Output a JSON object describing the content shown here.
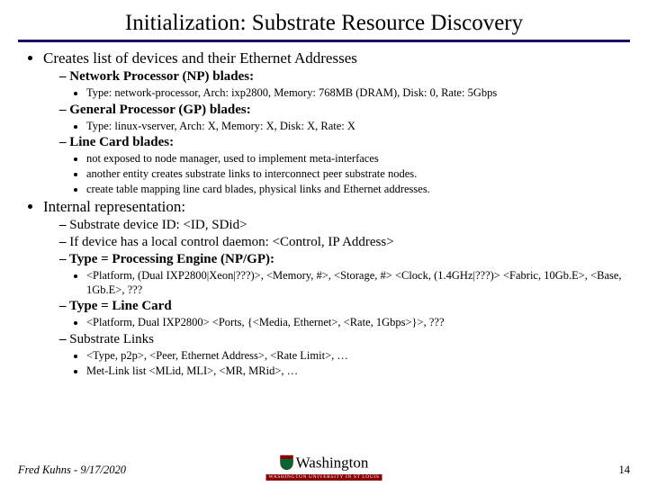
{
  "title": "Initialization: Substrate Resource Discovery",
  "b1": {
    "head": "Creates list of devices and their Ethernet Addresses",
    "np": {
      "head": "Network Processor (NP) blades:",
      "d": "Type: network-processor, Arch: ixp2800, Memory: 768MB (DRAM), Disk: 0, Rate: 5Gbps"
    },
    "gp": {
      "head": "General Processor (GP) blades:",
      "d": "Type: linux-vserver, Arch: X, Memory: X, Disk: X, Rate: X"
    },
    "lc": {
      "head": "Line Card blades:",
      "d1": "not exposed to node manager, used to implement meta-interfaces",
      "d2": "another entity creates substrate links to interconnect peer substrate nodes.",
      "d3": "create table mapping line card blades, physical links and Ethernet addresses."
    }
  },
  "b2": {
    "head": "Internal representation:",
    "sid": "Substrate device ID: <ID,  SDid>",
    "daemon": "If device has  a local control daemon: <Control, IP Address>",
    "pe": {
      "head": "Type = Processing Engine (NP/GP):",
      "d": "<Platform, (Dual IXP2800|Xeon|???)>, <Memory, #>, <Storage, #> <Clock, (1.4GHz|???)> <Fabric, 10Gb.E>, <Base, 1Gb.E>, ???"
    },
    "lc2": {
      "head": "Type = Line Card",
      "d": "<Platform, Dual IXP2800> <Ports, {<Media, Ethernet>, <Rate, 1Gbps>}>, ???"
    },
    "links": {
      "head": "Substrate Links",
      "d1": "<Type, p2p>, <Peer, Ethernet Address>, <Rate Limit>, …",
      "d2": "Met-Link list <MLid, MLI>, <MR, MRid>, …"
    }
  },
  "footer": {
    "author_date": "Fred Kuhns - 9/17/2020",
    "page": "14"
  },
  "logo": {
    "univ": "Washington",
    "sub": "WASHINGTON UNIVERSITY IN ST LOUIS"
  }
}
